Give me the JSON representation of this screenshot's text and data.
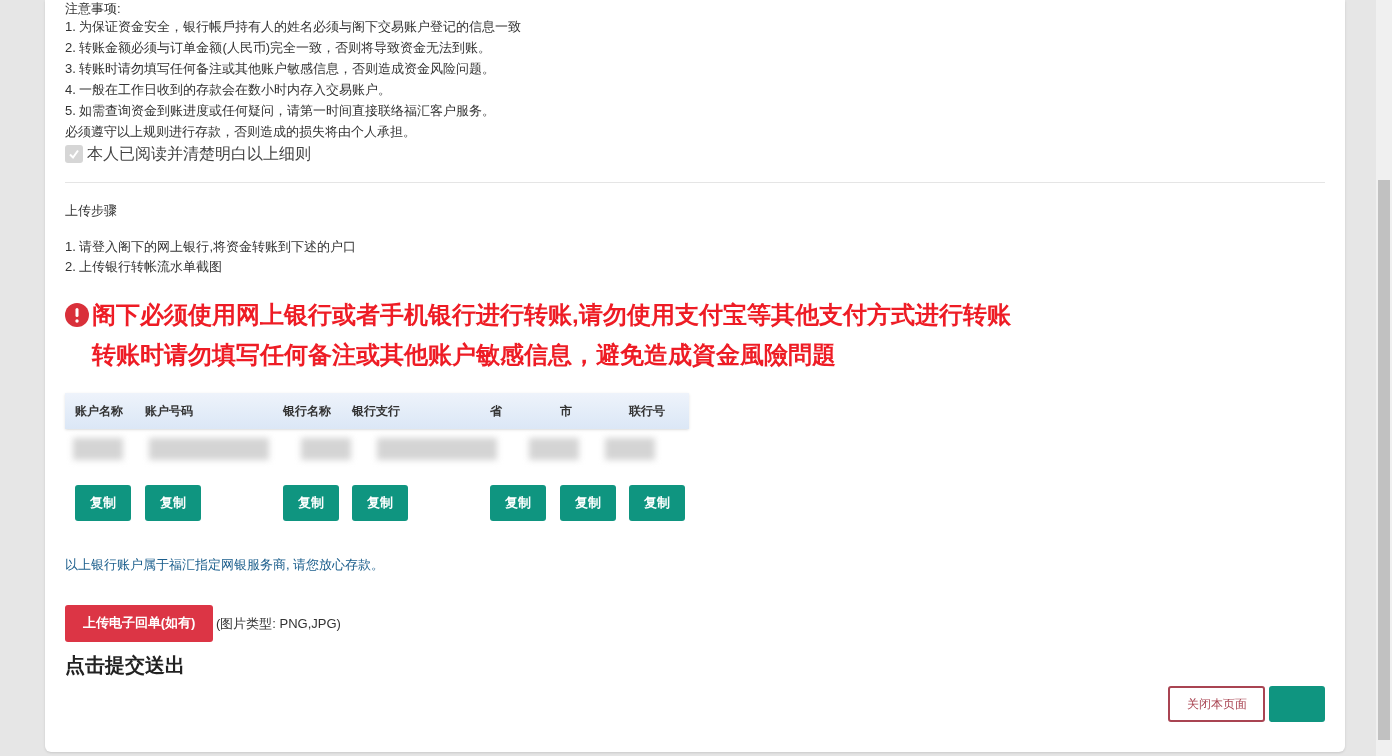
{
  "notice": {
    "title": "注意事项:",
    "items": [
      "1. 为保证资金安全，银行帳戶持有人的姓名必须与阁下交易账户登记的信息一致",
      "2. 转账金额必须与订单金额(人民币)完全一致，否则将导致资金无法到账。",
      "3. 转账时请勿填写任何备注或其他账户敏感信息，否则造成资金风险问题。",
      "4. 一般在工作日收到的存款会在数小时内存入交易账户。",
      "5. 如需查询资金到账进度或任何疑问，请第一时间直接联络福汇客户服务。",
      "必须遵守以上规则进行存款，否则造成的损失将由个人承担。"
    ],
    "agreement": {
      "label": "本人已阅读并清楚明白以上细则",
      "checked": true,
      "disabled": true
    }
  },
  "upload_steps": {
    "title": "上传步骤",
    "items": [
      "1. 请登入阁下的网上银行,将资金转账到下述的户口",
      "2. 上传银行转帐流水单截图"
    ]
  },
  "warning": [
    "阁下必须使用网上银行或者手机银行进行转账,请勿使用支付宝等其他支付方式进行转账",
    "转账时请勿填写任何备注或其他账户敏感信息，避免造成資金風險問題"
  ],
  "table": {
    "columns": [
      {
        "label": "账户名称",
        "copy": "复制",
        "wide": false
      },
      {
        "label": "账户号码",
        "copy": "复制",
        "wide": true
      },
      {
        "label": "银行名称",
        "copy": "复制",
        "wide": false
      },
      {
        "label": "银行支行",
        "copy": "复制",
        "wide": true
      },
      {
        "label": "省",
        "copy": "复制",
        "wide": false
      },
      {
        "label": "市",
        "copy": "复制",
        "wide": false
      },
      {
        "label": "联行号",
        "copy": "复制",
        "wide": false
      }
    ],
    "redacted_cells": [
      {
        "wide": false
      },
      {
        "wide": true
      },
      {
        "wide": false
      },
      {
        "wide": true
      },
      {
        "wide": false
      },
      {
        "wide": false
      }
    ]
  },
  "account_note": "以上银行账户属于福汇指定网银服务商, 请您放心存款。",
  "upload": {
    "button": "上传电子回单(如有)",
    "hint": "(图片类型: PNG,JPG)"
  },
  "submit_title": "点击提交送出",
  "footer": {
    "close_button": "关闭本页面"
  }
}
